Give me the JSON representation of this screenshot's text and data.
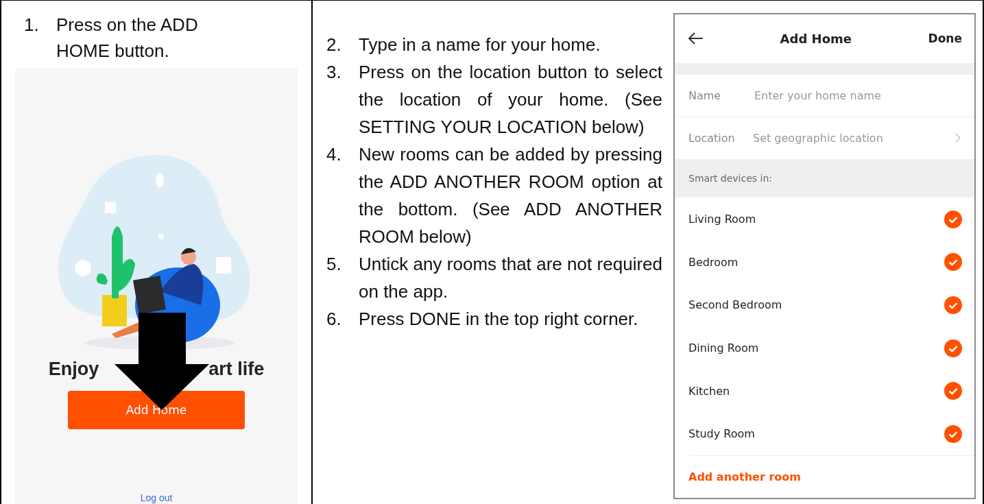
{
  "steps_left": [
    {
      "number": "1.",
      "text": "Press on the ADD HOME button."
    }
  ],
  "home_screen": {
    "heading_parts": [
      "Enjoy",
      "art life"
    ],
    "button": "Add Home",
    "link": "Log out"
  },
  "steps_right": [
    {
      "number": "2.",
      "text": "Type in a name for your home."
    },
    {
      "number": "3.",
      "text": "Press on the location button to select the location of your home.  (See SETTING YOUR LOCATION below)"
    },
    {
      "number": "4.",
      "text": "New rooms can be added by pressing the ADD ANOTHER ROOM option at the bottom. (See ADD ANOTHER ROOM below)"
    },
    {
      "number": "5.",
      "text": "Untick any rooms that are not required on the app."
    },
    {
      "number": "6.",
      "text": "Press DONE in the top right corner."
    }
  ],
  "add_home_screen": {
    "title": "Add Home",
    "action": "Done",
    "fields": [
      {
        "label": "Name",
        "placeholder": "Enter your home name"
      },
      {
        "label": "Location",
        "value": "Set geographic location"
      }
    ],
    "section": "Smart devices in:",
    "rooms": [
      {
        "name": "Living Room",
        "checked": true
      },
      {
        "name": "Bedroom",
        "checked": true
      },
      {
        "name": "Second Bedroom",
        "checked": true
      },
      {
        "name": "Dining Room",
        "checked": true
      },
      {
        "name": "Kitchen",
        "checked": true
      },
      {
        "name": "Study Room",
        "checked": true
      }
    ],
    "add_room": "Add another room"
  }
}
